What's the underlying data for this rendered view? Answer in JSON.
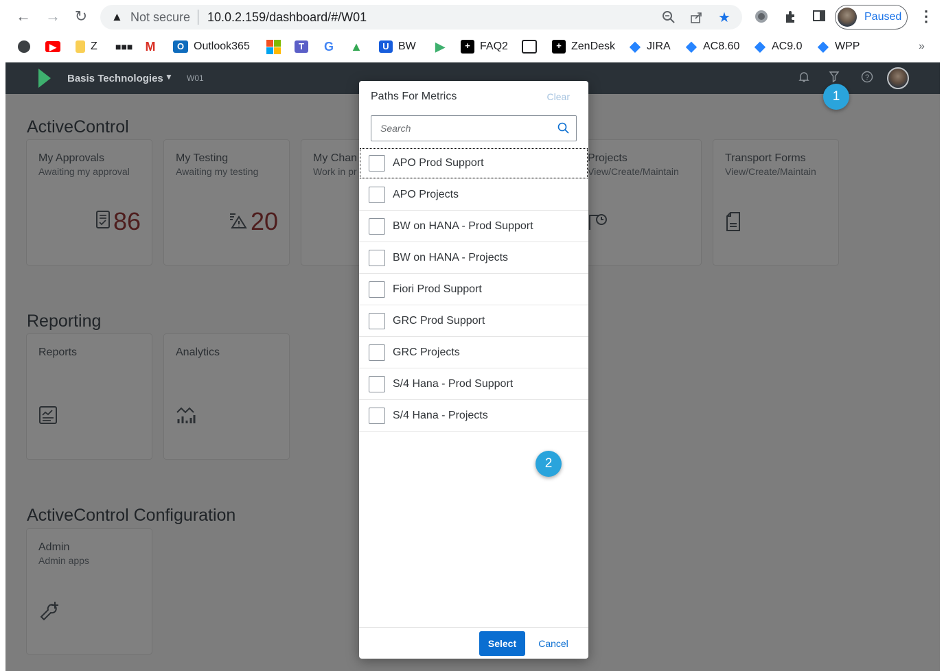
{
  "browser": {
    "not_secure": "Not secure",
    "url": "10.0.2.159/dashboard/#/W01",
    "profile_label": "Paused",
    "more_bookmarks": "»"
  },
  "bookmarks": [
    {
      "label": "",
      "icon": "puzzle-piece-app-icon"
    },
    {
      "label": "",
      "icon": "youtube-icon",
      "color": "#ff0000"
    },
    {
      "label": "Z",
      "icon": "folder-icon",
      "color": "#f9cf55"
    },
    {
      "label": "",
      "icon": "dots-app-icon"
    },
    {
      "label": "",
      "icon": "gmail-icon",
      "color": "#d93025"
    },
    {
      "label": "Outlook365",
      "icon": "outlook-icon",
      "color": "#0f6cbd"
    },
    {
      "label": "",
      "icon": "microsoft-icon"
    },
    {
      "label": "",
      "icon": "teams-icon",
      "color": "#5b5fc7"
    },
    {
      "label": "",
      "icon": "google-icon",
      "color": "#4285f4"
    },
    {
      "label": "",
      "icon": "drive-icon",
      "color": "#fbbc04"
    },
    {
      "label": "BW",
      "icon": "bw-shield-icon",
      "color": "#175ddc"
    },
    {
      "label": "",
      "icon": "basis-arrow-icon",
      "color": "#3eb06e"
    },
    {
      "label": "FAQ2",
      "icon": "plus-box-icon"
    },
    {
      "label": "",
      "icon": "book-icon"
    },
    {
      "label": "ZenDesk",
      "icon": "plus-box-icon"
    },
    {
      "label": "JIRA",
      "icon": "jira-diamond-icon",
      "color": "#2684ff"
    },
    {
      "label": "AC8.60",
      "icon": "jira-diamond-icon",
      "color": "#2684ff"
    },
    {
      "label": "AC9.0",
      "icon": "jira-diamond-icon",
      "color": "#2684ff"
    },
    {
      "label": "WPP",
      "icon": "jira-diamond-icon",
      "color": "#2684ff"
    }
  ],
  "app": {
    "brand": "Basis Technologies",
    "system_id": "W01",
    "groups": {
      "activecontrol": "ActiveControl",
      "reporting": "Reporting",
      "configuration": "ActiveControl Configuration"
    },
    "tiles": {
      "approvals": {
        "title": "My Approvals",
        "subtitle": "Awaiting my approval",
        "count": "86"
      },
      "testing": {
        "title": "My Testing",
        "subtitle": "Awaiting my testing",
        "count": "20"
      },
      "changes": {
        "title": "My Chan",
        "subtitle": "Work in pr"
      },
      "projects": {
        "title": "Projects",
        "subtitle": "View/Create/Maintain"
      },
      "transport_forms": {
        "title": "Transport Forms",
        "subtitle": "View/Create/Maintain"
      },
      "reports": {
        "title": "Reports"
      },
      "analytics": {
        "title": "Analytics"
      },
      "admin": {
        "title": "Admin",
        "subtitle": "Admin apps"
      }
    },
    "badges": {
      "one": "1",
      "two": "2"
    }
  },
  "dialog": {
    "title": "Paths For Metrics",
    "clear": "Clear",
    "search_placeholder": "Search",
    "items": [
      {
        "label": "APO Prod Support",
        "checked": false
      },
      {
        "label": "APO Projects",
        "checked": false
      },
      {
        "label": "BW on HANA - Prod Support",
        "checked": false
      },
      {
        "label": "BW on HANA - Projects",
        "checked": false
      },
      {
        "label": "Fiori Prod Support",
        "checked": false
      },
      {
        "label": "GRC Prod Support",
        "checked": false
      },
      {
        "label": "GRC Projects",
        "checked": false
      },
      {
        "label": "S/4 Hana - Prod Support",
        "checked": false
      },
      {
        "label": "S/4 Hana - Projects",
        "checked": false
      }
    ],
    "select_label": "Select",
    "cancel_label": "Cancel"
  }
}
